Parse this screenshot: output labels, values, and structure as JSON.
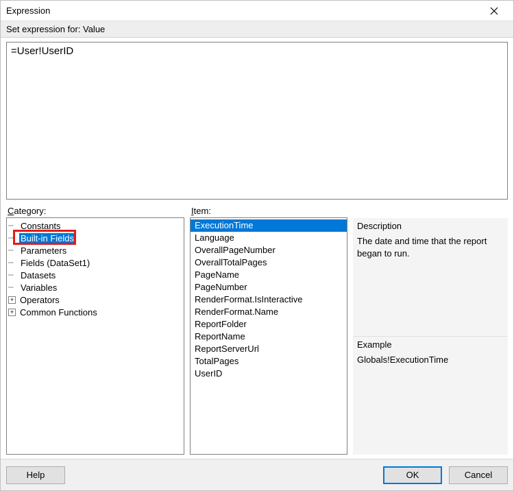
{
  "window": {
    "title": "Expression"
  },
  "subheader": {
    "label_prefix": "Set expression for: ",
    "target": "Value"
  },
  "editor": {
    "value": "=User!UserID"
  },
  "labels": {
    "category": "Category:",
    "item": "Item:",
    "description": "Description",
    "example": "Example"
  },
  "category": {
    "items": [
      {
        "label": "Constants",
        "expander": null,
        "indent": true,
        "selected": false
      },
      {
        "label": "Built-in Fields",
        "expander": null,
        "indent": true,
        "selected": true
      },
      {
        "label": "Parameters",
        "expander": null,
        "indent": true,
        "selected": false
      },
      {
        "label": "Fields (DataSet1)",
        "expander": null,
        "indent": true,
        "selected": false
      },
      {
        "label": "Datasets",
        "expander": null,
        "indent": true,
        "selected": false
      },
      {
        "label": "Variables",
        "expander": null,
        "indent": true,
        "selected": false
      },
      {
        "label": "Operators",
        "expander": "+",
        "indent": false,
        "selected": false
      },
      {
        "label": "Common Functions",
        "expander": "+",
        "indent": false,
        "selected": false
      }
    ]
  },
  "item": {
    "items": [
      {
        "label": "ExecutionTime",
        "selected": true
      },
      {
        "label": "Language",
        "selected": false
      },
      {
        "label": "OverallPageNumber",
        "selected": false
      },
      {
        "label": "OverallTotalPages",
        "selected": false
      },
      {
        "label": "PageName",
        "selected": false
      },
      {
        "label": "PageNumber",
        "selected": false
      },
      {
        "label": "RenderFormat.IsInteractive",
        "selected": false
      },
      {
        "label": "RenderFormat.Name",
        "selected": false
      },
      {
        "label": "ReportFolder",
        "selected": false
      },
      {
        "label": "ReportName",
        "selected": false
      },
      {
        "label": "ReportServerUrl",
        "selected": false
      },
      {
        "label": "TotalPages",
        "selected": false
      },
      {
        "label": "UserID",
        "selected": false
      }
    ]
  },
  "description_text": "The date and time that the report began to run.",
  "example_text": "Globals!ExecutionTime",
  "footer": {
    "help": "Help",
    "ok": "OK",
    "cancel": "Cancel"
  }
}
